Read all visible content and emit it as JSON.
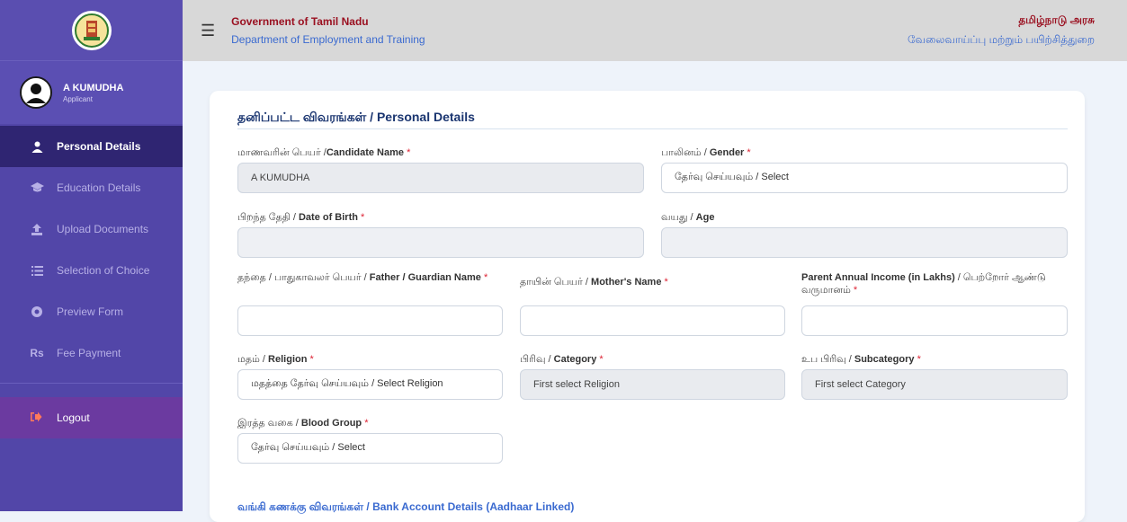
{
  "header": {
    "gov_en": "Government of Tamil Nadu",
    "dept_en": "Department of Employment and Training",
    "gov_ta": "தமிழ்நாடு அரசு",
    "dept_ta": "வேலைவாய்ப்பு மற்றும் பயிற்சித்துறை"
  },
  "user": {
    "name": "A KUMUDHA",
    "role": "Applicant"
  },
  "sidebar": {
    "items": [
      {
        "label": "Personal Details",
        "icon": "user-icon"
      },
      {
        "label": "Education Details",
        "icon": "graduation-cap-icon"
      },
      {
        "label": "Upload Documents",
        "icon": "upload-icon"
      },
      {
        "label": "Selection of Choice",
        "icon": "list-icon"
      },
      {
        "label": "Preview Form",
        "icon": "eye-icon"
      },
      {
        "label": "Fee Payment",
        "icon": "rupee-icon"
      }
    ],
    "logout": "Logout"
  },
  "form": {
    "section_title": "தனிப்பட்ட விவரங்கள் / Personal Details",
    "candidate_name": {
      "label_ta": "மாணவரின் பெயர் /",
      "label_en": "Candidate Name",
      "value": "A KUMUDHA"
    },
    "gender": {
      "label_ta": "பாலினம் / ",
      "label_en": "Gender",
      "value": "தேர்வு செய்யவும் / Select"
    },
    "dob": {
      "label_ta": "பிறந்த தேதி / ",
      "label_en": "Date of Birth",
      "value": ""
    },
    "age": {
      "label_ta": "வயது / ",
      "label_en": "Age",
      "value": ""
    },
    "father": {
      "label_ta": "தந்தை / பாதுகாவலர் பெயர் / ",
      "label_en": "Father / Guardian Name",
      "value": ""
    },
    "mother": {
      "label_ta": "தாயின் பெயர் / ",
      "label_en": "Mother's Name",
      "value": ""
    },
    "income": {
      "label_en": "Parent Annual Income (in Lakhs)",
      "label_ta": " / பெற்றோர் ஆண்டு வருமானம்",
      "value": ""
    },
    "religion": {
      "label_ta": "மதம் / ",
      "label_en": "Religion",
      "value": "மதத்தை தேர்வு செய்யவும் / Select Religion"
    },
    "category": {
      "label_ta": "பிரிவு / ",
      "label_en": "Category",
      "value": "First select Religion"
    },
    "subcategory": {
      "label_ta": "உப பிரிவு / ",
      "label_en": "Subcategory",
      "value": "First select Category"
    },
    "blood": {
      "label_ta": "இரத்த வகை / ",
      "label_en": "Blood Group",
      "value": "தேர்வு செய்யவும் / Select"
    },
    "required_mark": "*",
    "bank_title": "வங்கி கணக்கு விவரங்கள் / Bank Account Details (Aadhaar Linked)"
  }
}
